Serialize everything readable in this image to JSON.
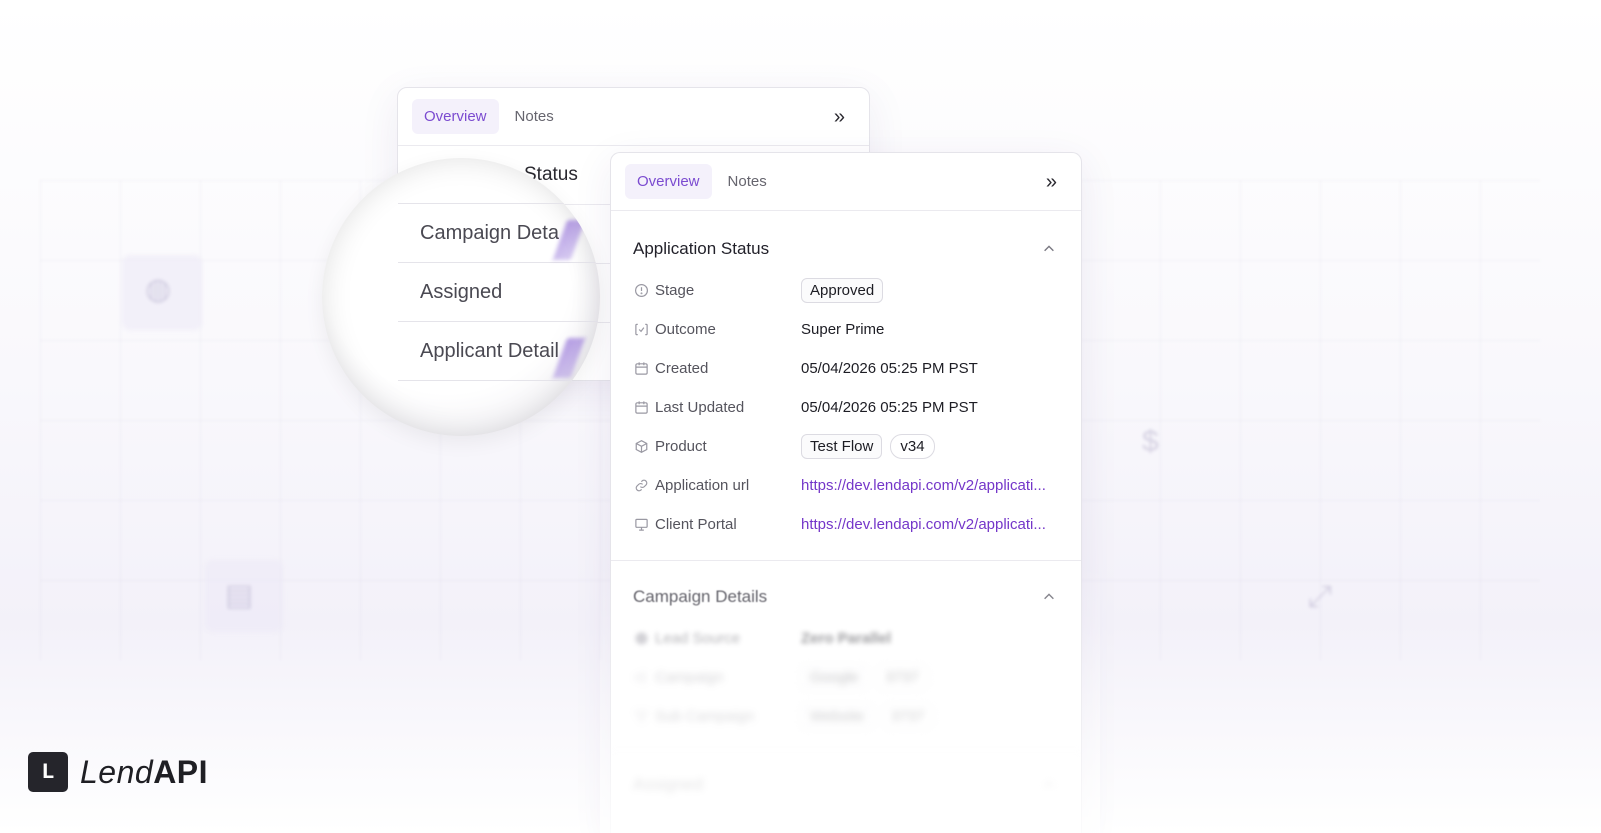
{
  "back_panel": {
    "tabs": [
      {
        "label": "Overview",
        "active": true
      },
      {
        "label": "Notes",
        "active": false
      }
    ],
    "expand_icon": "double-chevron-right-icon",
    "partial_heading": "Status"
  },
  "magnifier": {
    "rows": [
      "Campaign Deta",
      "Assigned",
      "Applicant Detail"
    ]
  },
  "front_panel": {
    "tabs": [
      {
        "label": "Overview",
        "active": true
      },
      {
        "label": "Notes",
        "active": false
      }
    ],
    "expand_icon": "double-chevron-right-icon",
    "application_status": {
      "title": "Application Status",
      "collapse_icon": "chevron-up-icon",
      "fields": {
        "stage": {
          "label": "Stage",
          "icon": "clock-alert-icon",
          "value": "Approved"
        },
        "outcome": {
          "label": "Outcome",
          "icon": "outcome-check-icon",
          "value": "Super Prime"
        },
        "created": {
          "label": "Created",
          "icon": "calendar-icon",
          "value": "05/04/2026 05:25 PM PST"
        },
        "last_updated": {
          "label": "Last Updated",
          "icon": "calendar-icon",
          "value": "05/04/2026 05:25 PM PST"
        },
        "product": {
          "label": "Product",
          "icon": "box-icon",
          "value": "Test Flow",
          "version": "v34"
        },
        "application_url": {
          "label": "Application url",
          "icon": "link-icon",
          "value": "https://dev.lendapi.com/v2/applicati..."
        },
        "client_portal": {
          "label": "Client Portal",
          "icon": "monitor-icon",
          "value": "https://dev.lendapi.com/v2/applicati..."
        }
      }
    },
    "campaign_details": {
      "title": "Campaign Details",
      "collapse_icon": "chevron-up-icon",
      "fields": {
        "lead_source": {
          "label": "Lead Source",
          "value": "Zero Parallel"
        },
        "campaign": {
          "label": "Campaign",
          "value": "Google",
          "id": "3737"
        },
        "sub_campaign": {
          "label": "Sub Campaign",
          "value": "Website",
          "id": "3737"
        }
      }
    },
    "assigned": {
      "title": "Assigned"
    }
  },
  "logo": {
    "lend": "Lend",
    "api": "API",
    "mark": "L"
  },
  "colors": {
    "accent": "#7b4bd0",
    "link": "#7436c9",
    "text": "#1d1d24"
  }
}
